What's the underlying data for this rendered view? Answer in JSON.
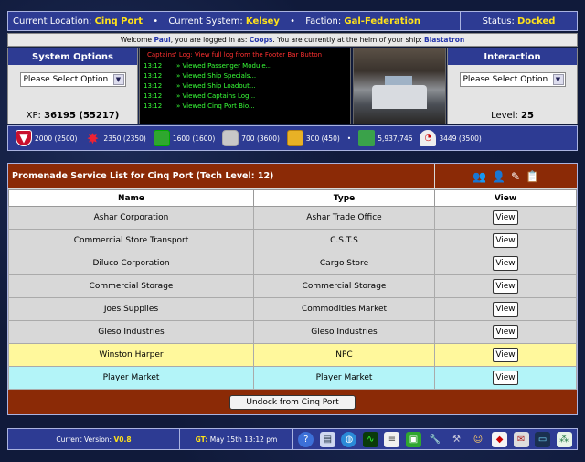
{
  "topbar": {
    "location_label": "Current Location:",
    "location": "Cinq Port",
    "system_label": "Current System:",
    "system": "Kelsey",
    "faction_label": "Faction:",
    "faction": "Gal-Federation",
    "status_label": "Status:",
    "status": "Docked"
  },
  "welcome": {
    "pre": "Welcome",
    "user": "Paul",
    "mid": ", you are logged in as:",
    "login": "Coops",
    "post": ". You are currently at the helm of your ship:",
    "ship": "Blastatron"
  },
  "system_options": {
    "title": "System Options",
    "select_value": "Please Select Option",
    "xp_label": "XP:",
    "xp_value": "36195 (55217)"
  },
  "interaction": {
    "title": "Interaction",
    "select_value": "Please Select Option",
    "level_label": "Level:",
    "level_value": "25"
  },
  "captains_log": {
    "header_title": "Captains' Log:",
    "header_note": "View full log from the Footer Bar Button",
    "entries": [
      {
        "time": "13:12",
        "text": "» Viewed Passenger Module..."
      },
      {
        "time": "13:12",
        "text": "» Viewed Ship Specials..."
      },
      {
        "time": "13:12",
        "text": "» Viewed Ship Loadout..."
      },
      {
        "time": "13:12",
        "text": "» Viewed Captains Log..."
      },
      {
        "time": "13:12",
        "text": "» Viewed Cinq Port Bio..."
      }
    ]
  },
  "resources": {
    "shields": "2000 (2500)",
    "hull": "2350 (2350)",
    "cargo": "1600 (1600)",
    "fuel": "700 (3600)",
    "crates": "300 (450)",
    "credits": "5,937,746",
    "gauge": "3449 (3500)"
  },
  "service_list": {
    "title": "Promenade Service List for Cinq Port (Tech Level: 12)",
    "col_name": "Name",
    "col_type": "Type",
    "col_view": "View",
    "view_label": "View",
    "rows": [
      {
        "name": "Ashar Corporation",
        "type": "Ashar Trade Office"
      },
      {
        "name": "Commercial Store Transport",
        "type": "C.S.T.S"
      },
      {
        "name": "Diluco Corporation",
        "type": "Cargo Store"
      },
      {
        "name": "Commercial Storage",
        "type": "Commercial Storage"
      },
      {
        "name": "Joes Supplies",
        "type": "Commodities Market"
      },
      {
        "name": "Gleso Industries",
        "type": "Gleso Industries"
      },
      {
        "name": "Winston Harper",
        "type": "NPC"
      },
      {
        "name": "Player Market",
        "type": "Player Market"
      }
    ],
    "undock_label": "Undock from Cinq Port"
  },
  "footer": {
    "version_label": "Current Version:",
    "version": "V0.8",
    "gt_label": "GT:",
    "gt_value": "May 15th 13:12 pm"
  }
}
